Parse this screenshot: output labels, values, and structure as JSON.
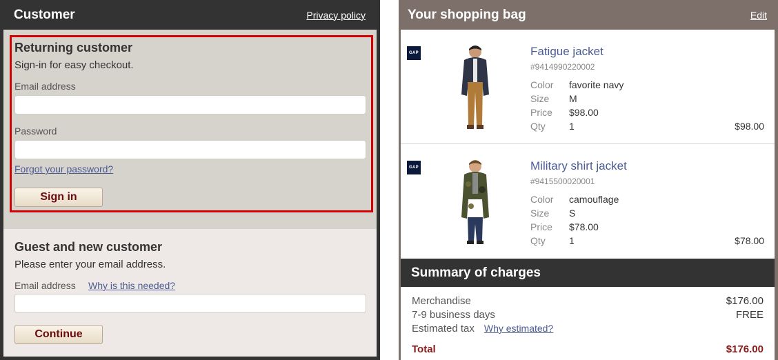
{
  "customer": {
    "title": "Customer",
    "privacy_link": "Privacy policy",
    "returning": {
      "title": "Returning customer",
      "subtitle": "Sign-in for easy checkout.",
      "email_label": "Email address",
      "email_value": "",
      "password_label": "Password",
      "password_value": "",
      "forgot_link": "Forgot your password?",
      "sign_in_button": "Sign in"
    },
    "guest": {
      "title": "Guest and new customer",
      "subtitle": "Please enter your email address.",
      "email_label": "Email address",
      "why_link": "Why is this needed?",
      "email_value": "",
      "continue_button": "Continue"
    }
  },
  "bag": {
    "title": "Your shopping bag",
    "edit_link": "Edit",
    "brand_logo": "GAP",
    "attr_labels": {
      "color": "Color",
      "size": "Size",
      "price": "Price",
      "qty": "Qty"
    },
    "items": [
      {
        "name": "Fatigue jacket",
        "sku": "#9414990220002",
        "color": "favorite navy",
        "size": "M",
        "price": "$98.00",
        "qty": "1",
        "total": "$98.00",
        "jacket_color": "#2f3547",
        "pants_color": "#b07a38"
      },
      {
        "name": "Military shirt jacket",
        "sku": "#9415500020001",
        "color": "camouflage",
        "size": "S",
        "price": "$78.00",
        "qty": "1",
        "total": "$78.00",
        "jacket_color": "#4a5230",
        "pants_color": "#2b3a5c"
      }
    ]
  },
  "summary": {
    "title": "Summary of charges",
    "merchandise_label": "Merchandise",
    "merchandise_value": "$176.00",
    "shipping_label": "7-9 business days",
    "shipping_value": "FREE",
    "tax_label": "Estimated tax",
    "tax_link": "Why estimated?",
    "total_label": "Total",
    "total_value": "$176.00"
  },
  "colors": {
    "dark_panel": "#333333",
    "bag_panel": "#7d706b",
    "highlight": "#d20000",
    "link": "#4b5b93",
    "button_text": "#6a0c0c"
  }
}
